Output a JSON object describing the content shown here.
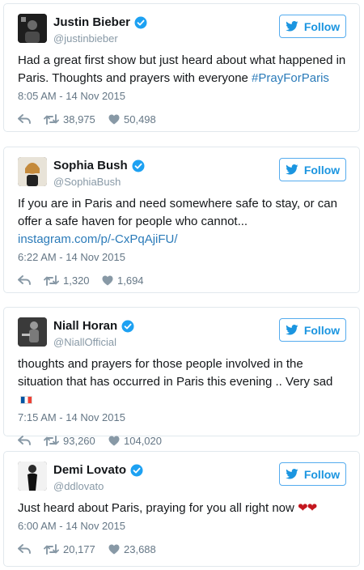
{
  "tweets": [
    {
      "name": "Justin Bieber",
      "handle": "@justinbieber",
      "follow_label": "Follow",
      "text": "Had a great first show but just heard about what happened in Paris. Thoughts and prayers with everyone ",
      "hashtag": "#PrayForParis",
      "time": "8:05 AM - 14 Nov 2015",
      "retweets": "38,975",
      "likes": "50,498"
    },
    {
      "name": "Sophia Bush",
      "handle": "@SophiaBush",
      "follow_label": "Follow",
      "text": "If you are in Paris and need somewhere safe to stay, or can offer a safe haven for people who cannot... ",
      "link": "instagram.com/p/-CxPqAjiFU/",
      "time": "6:22 AM - 14 Nov 2015",
      "retweets": "1,320",
      "likes": "1,694"
    },
    {
      "name": "Niall Horan",
      "handle": "@NiallOfficial",
      "follow_label": "Follow",
      "text": "thoughts and prayers for those people involved in the situation that has occurred in Paris this evening .. Very sad",
      "emoji": "french-flag",
      "time": "7:15 AM - 14 Nov 2015",
      "retweets": "93,260",
      "likes": "104,020"
    },
    {
      "name": "Demi Lovato",
      "handle": "@ddlovato",
      "follow_label": "Follow",
      "text": "Just heard about Paris, praying for you all right now ",
      "emoji_text": "❤❤",
      "time": "6:00 AM - 14 Nov 2015",
      "retweets": "20,177",
      "likes": "23,688"
    }
  ],
  "colors": {
    "accent": "#1b95e0",
    "link": "#2b7bb9",
    "border": "#e1e8ed",
    "meta": "#657786",
    "heart": "#c4171f"
  },
  "icons": {
    "verified": "verified-badge-icon",
    "follow": "twitter-bird-icon",
    "reply": "reply-icon",
    "retweet": "retweet-icon",
    "like": "heart-icon"
  }
}
